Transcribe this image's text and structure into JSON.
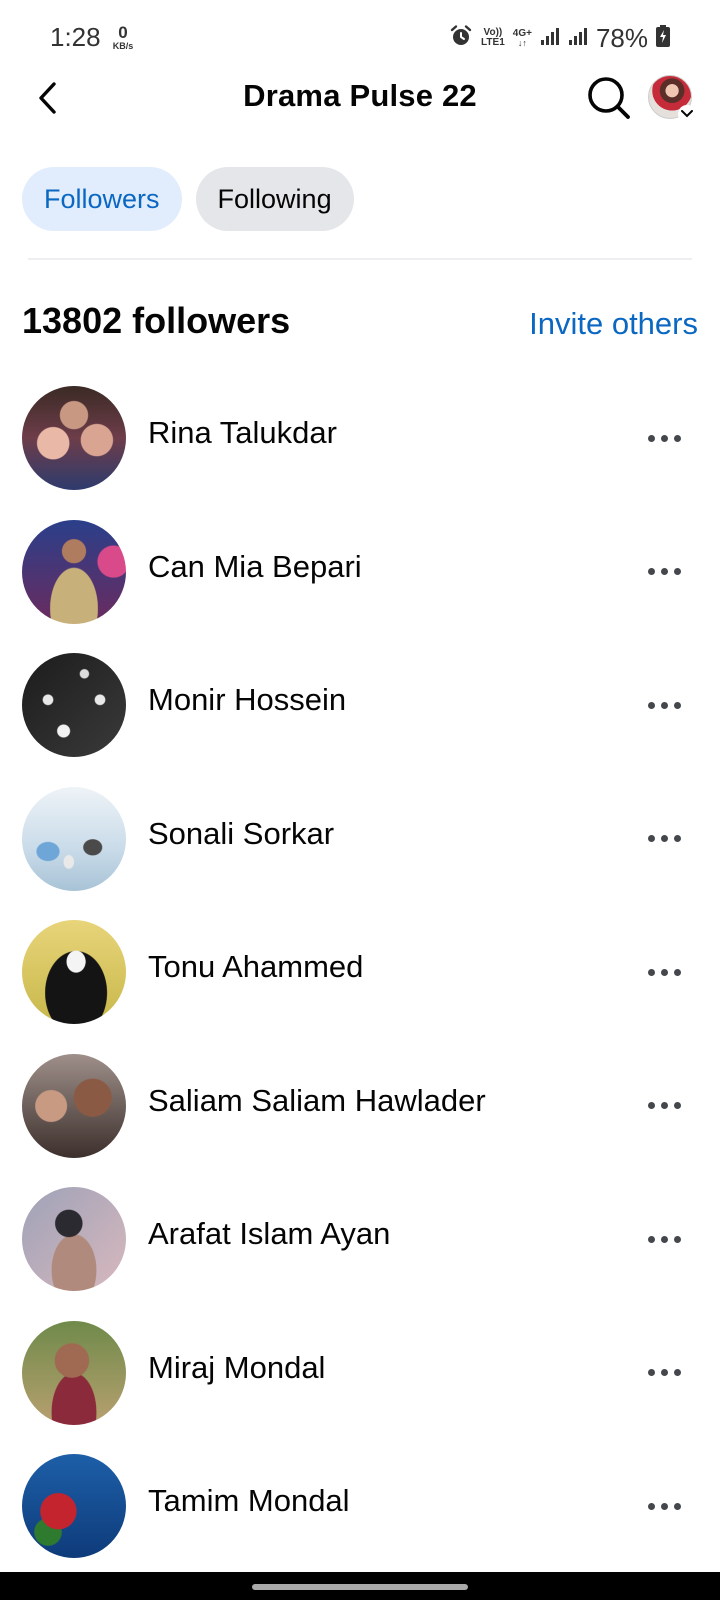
{
  "status_bar": {
    "time": "1:28",
    "net_speed_value": "0",
    "net_speed_unit": "KB/s",
    "volte_label": "Vo))",
    "lte_label": "LTE1",
    "network_type": "4G+",
    "battery": "78%"
  },
  "header": {
    "title": "Drama Pulse 22"
  },
  "tabs": [
    {
      "label": "Followers",
      "active": true
    },
    {
      "label": "Following",
      "active": false
    }
  ],
  "followers_section": {
    "count_title": "13802 followers",
    "invite_label": "Invite others"
  },
  "followers": [
    {
      "name": "Rina Talukdar"
    },
    {
      "name": "Can Mia Bepari"
    },
    {
      "name": "Monir Hossein"
    },
    {
      "name": "Sonali Sorkar"
    },
    {
      "name": "Tonu Ahammed"
    },
    {
      "name": "Saliam Saliam Hawlader"
    },
    {
      "name": "Arafat Islam Ayan"
    },
    {
      "name": "Miraj Mondal"
    },
    {
      "name": "Tamim Mondal"
    }
  ],
  "colors": {
    "accent": "#0a67c2",
    "active_tab_bg": "#e1edfc",
    "inactive_tab_bg": "#e4e6e9"
  },
  "icons": {
    "back": "chevron-left-icon",
    "search": "search-icon",
    "more": "more-horizontal-icon",
    "alarm": "alarm-icon",
    "signal": "signal-icon",
    "battery": "battery-charging-icon"
  }
}
